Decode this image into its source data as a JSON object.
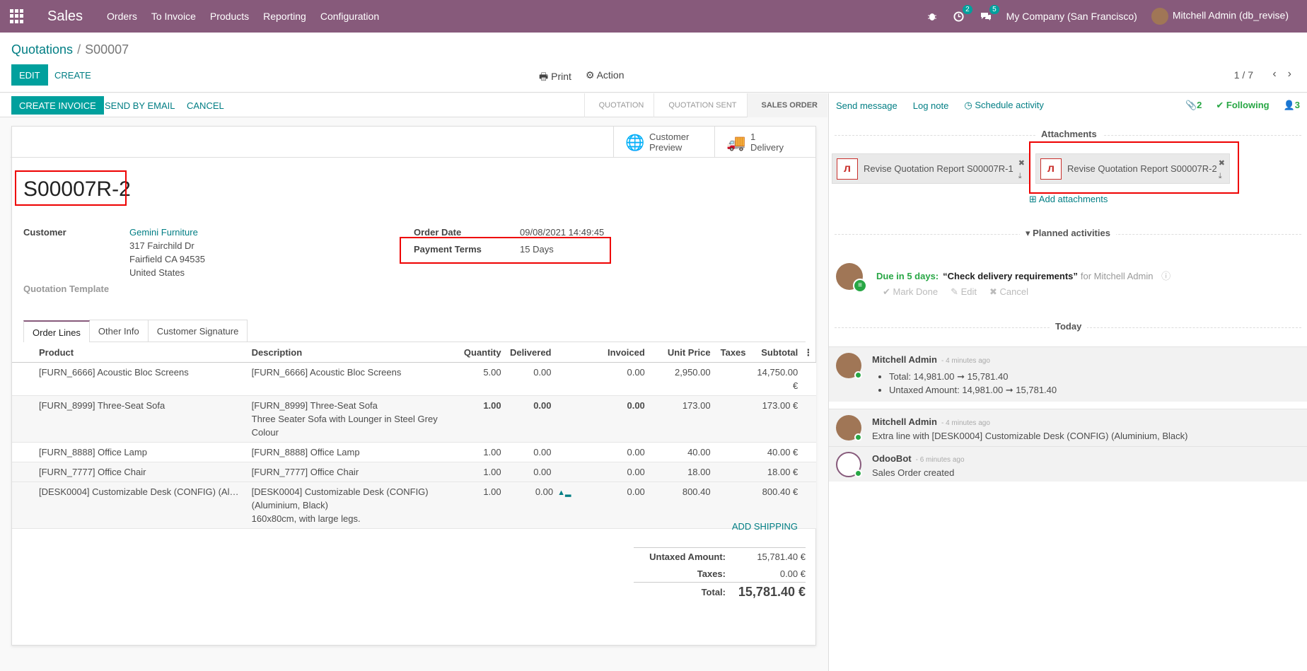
{
  "navbar": {
    "app_name": "Sales",
    "menu": [
      "Orders",
      "To Invoice",
      "Products",
      "Reporting",
      "Configuration"
    ],
    "activity_count": "2",
    "message_count": "5",
    "company": "My Company (San Francisco)",
    "user": "Mitchell Admin (db_revise)"
  },
  "control": {
    "breadcrumb_parent": "Quotations",
    "breadcrumb_current": "S00007",
    "edit_label": "EDIT",
    "create_label": "CREATE",
    "print_label": "Print",
    "action_label": "Action",
    "pager": "1 / 7"
  },
  "statusbar": {
    "create_invoice": "CREATE INVOICE",
    "send_email": "SEND BY EMAIL",
    "cancel": "CANCEL",
    "stages": [
      "QUOTATION",
      "QUOTATION SENT",
      "SALES ORDER"
    ],
    "active_stage": "SALES ORDER"
  },
  "smart_buttons": {
    "preview_line1": "Customer",
    "preview_line2": "Preview",
    "delivery_count": "1",
    "delivery_label": "Delivery"
  },
  "form": {
    "title": "S00007R-2",
    "customer_label": "Customer",
    "customer_name": "Gemini Furniture",
    "address_line1": "317 Fairchild Dr",
    "address_line2": "Fairfield CA 94535",
    "address_line3": "United States",
    "template_label": "Quotation Template",
    "order_date_label": "Order Date",
    "order_date": "09/08/2021 14:49:45",
    "payment_terms_label": "Payment Terms",
    "payment_terms": "15 Days"
  },
  "tabs": [
    "Order Lines",
    "Other Info",
    "Customer Signature"
  ],
  "table": {
    "headers": [
      "Product",
      "Description",
      "Quantity",
      "Delivered",
      "Invoiced",
      "Unit Price",
      "Taxes",
      "Subtotal"
    ],
    "rows": [
      {
        "product": "[FURN_6666] Acoustic Bloc Screens",
        "desc1": "[FURN_6666] Acoustic Bloc Screens",
        "desc2": "",
        "desc3": "",
        "qty": "5.00",
        "delivered": "0.00",
        "invoiced": "0.00",
        "price": "2,950.00",
        "taxes": "",
        "subtotal": "14,750.00 €"
      },
      {
        "product": "[FURN_8999] Three-Seat Sofa",
        "desc1": "[FURN_8999] Three-Seat Sofa",
        "desc2": "Three Seater Sofa with Lounger in Steel Grey",
        "desc3": "Colour",
        "qty": "1.00",
        "delivered": "0.00",
        "invoiced": "0.00",
        "price": "173.00",
        "taxes": "",
        "subtotal": "173.00 €"
      },
      {
        "product": "[FURN_8888] Office Lamp",
        "desc1": "[FURN_8888] Office Lamp",
        "desc2": "",
        "desc3": "",
        "qty": "1.00",
        "delivered": "0.00",
        "invoiced": "0.00",
        "price": "40.00",
        "taxes": "",
        "subtotal": "40.00 €"
      },
      {
        "product": "[FURN_7777] Office Chair",
        "desc1": "[FURN_7777] Office Chair",
        "desc2": "",
        "desc3": "",
        "qty": "1.00",
        "delivered": "0.00",
        "invoiced": "0.00",
        "price": "18.00",
        "taxes": "",
        "subtotal": "18.00 €"
      },
      {
        "product": "[DESK0004] Customizable Desk (CONFIG) (Al…",
        "desc1": "[DESK0004] Customizable Desk (CONFIG)",
        "desc2": "(Aluminium, Black)",
        "desc3": "160x80cm, with large legs.",
        "qty": "1.00",
        "delivered": "0.00",
        "invoiced": "0.00",
        "price": "800.40",
        "taxes": "",
        "subtotal": "800.40 €"
      }
    ]
  },
  "add_shipping": "ADD SHIPPING",
  "totals": {
    "untaxed_label": "Untaxed Amount:",
    "untaxed": "15,781.40 €",
    "taxes_label": "Taxes:",
    "taxes": "0.00 €",
    "total_label": "Total:",
    "total": "15,781.40 €"
  },
  "chatter": {
    "send_message": "Send message",
    "log_note": "Log note",
    "schedule_activity": "Schedule activity",
    "attachment_count": "2",
    "following": "Following",
    "follower_count": "3",
    "attachments_title": "Attachments",
    "attachments": [
      "Revise Quotation Report S00007R-1",
      "Revise Quotation Report S00007R-2"
    ],
    "add_attachments": "Add attachments",
    "planned_title": "Planned activities",
    "activity": {
      "due": "Due in 5 days:",
      "summary": "“Check delivery requirements”",
      "for": "for Mitchell Admin",
      "mark_done": "Mark Done",
      "edit": "Edit",
      "cancel": "Cancel"
    },
    "today_title": "Today",
    "messages": [
      {
        "author": "Mitchell Admin",
        "date": "- 4 minutes ago",
        "line1": "Total: 14,981.00 ➞ 15,781.40",
        "line2": "Untaxed Amount: 14,981.00 ➞ 15,781.40"
      },
      {
        "author": "Mitchell Admin",
        "date": "- 4 minutes ago",
        "line1": "Extra line with [DESK0004] Customizable Desk (CONFIG) (Aluminium, Black)"
      },
      {
        "author": "OdooBot",
        "date": "- 6 minutes ago",
        "line1": "Sales Order created"
      }
    ]
  },
  "colors": {
    "brand": "#875a7b",
    "accent": "#00a09d",
    "highlight": "#ee0000"
  }
}
